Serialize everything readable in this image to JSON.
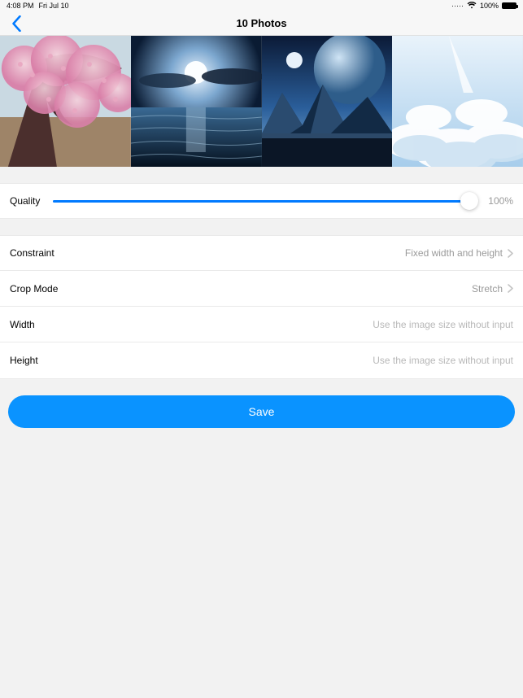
{
  "status": {
    "time": "4:08 PM",
    "date": "Fri Jul 10",
    "battery": "100%"
  },
  "nav": {
    "title": "10 Photos"
  },
  "quality": {
    "label": "Quality",
    "value": "100%"
  },
  "rows": {
    "constraint": {
      "label": "Constraint",
      "value": "Fixed width and height"
    },
    "cropmode": {
      "label": "Crop Mode",
      "value": "Stretch"
    },
    "width": {
      "label": "Width",
      "placeholder": "Use the image size without input"
    },
    "height": {
      "label": "Height",
      "placeholder": "Use the image size without input"
    }
  },
  "save": {
    "label": "Save"
  }
}
